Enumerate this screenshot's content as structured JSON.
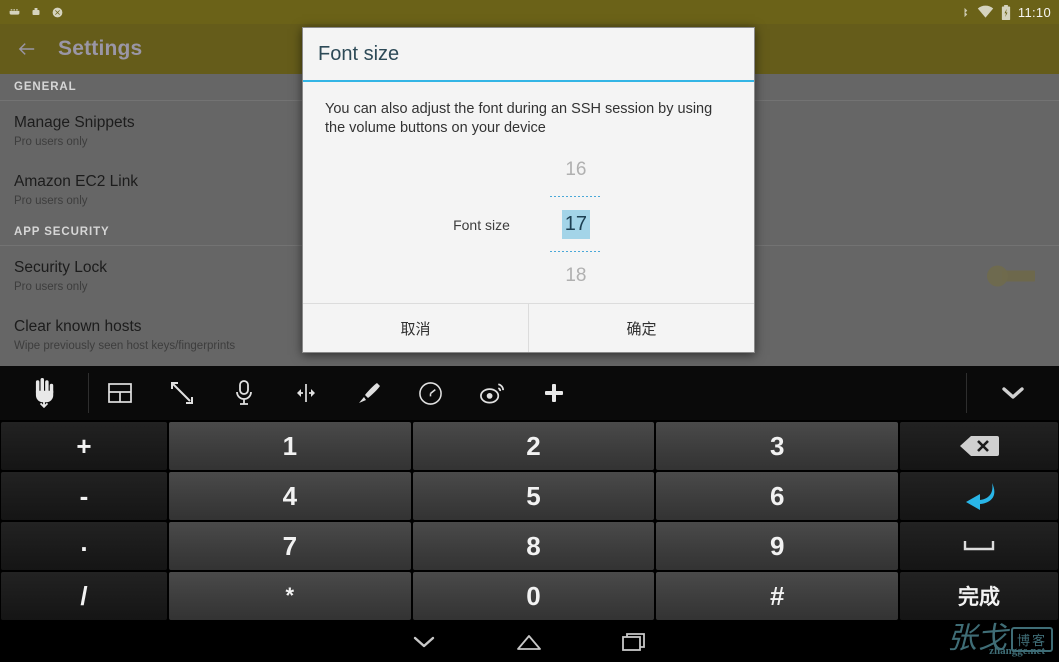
{
  "status_bar": {
    "time": "11:10",
    "left_icons": [
      "usb-icon",
      "alarm-icon",
      "app-notification-icon"
    ],
    "right_icons": [
      "bluetooth-icon",
      "wifi-icon",
      "battery-charging-icon"
    ]
  },
  "app_bar": {
    "back_icon": "back-arrow-icon",
    "title": "Settings",
    "bg_color": "#655C1A",
    "title_color": "#9a96a6"
  },
  "settings": {
    "sections": [
      {
        "header": "GENERAL",
        "rows": [
          {
            "title": "Manage Snippets",
            "subtitle": "Pro users only",
            "has_switch": false
          },
          {
            "title": "Amazon EC2 Link",
            "subtitle": "Pro users only",
            "has_switch": false
          }
        ]
      },
      {
        "header": "APP SECURITY",
        "rows": [
          {
            "title": "Security Lock",
            "subtitle": "Pro users only",
            "has_switch": true
          },
          {
            "title": "Clear known hosts",
            "subtitle": "Wipe previously seen host keys/fingerprints",
            "has_switch": false
          }
        ]
      }
    ]
  },
  "dialog": {
    "title": "Font size",
    "accent_color": "#33b5e5",
    "message": "You can also adjust the font during an SSH session by using the volume buttons on your device",
    "picker": {
      "label": "Font size",
      "previous_value": "16",
      "current_value": "17",
      "next_value": "18",
      "selection_color": "#a3d4e8"
    },
    "buttons": {
      "cancel": "取消",
      "ok": "确定"
    }
  },
  "ime_toolbar": {
    "first_icon": "hand-pointer-icon",
    "icons": [
      "layout-grid-icon",
      "expand-arrows-icon",
      "microphone-icon",
      "cursor-move-icon",
      "handwriting-pen-icon",
      "clock-icon",
      "weibo-icon",
      "plus-icon"
    ],
    "collapse_icon": "chevron-down-icon"
  },
  "keyboard": {
    "rows": [
      [
        {
          "label": "+",
          "type": "side",
          "name": "key-plus"
        },
        {
          "label": "1",
          "type": "num",
          "name": "key-1"
        },
        {
          "label": "2",
          "type": "num",
          "name": "key-2"
        },
        {
          "label": "3",
          "type": "num",
          "name": "key-3"
        },
        {
          "label": "",
          "type": "right",
          "name": "key-backspace",
          "icon": "backspace-icon"
        }
      ],
      [
        {
          "label": "-",
          "type": "side",
          "name": "key-minus"
        },
        {
          "label": "4",
          "type": "num",
          "name": "key-4"
        },
        {
          "label": "5",
          "type": "num",
          "name": "key-5"
        },
        {
          "label": "6",
          "type": "num",
          "name": "key-6"
        },
        {
          "label": "",
          "type": "right",
          "name": "key-enter",
          "icon": "enter-return-icon"
        }
      ],
      [
        {
          "label": ".",
          "type": "side",
          "name": "key-period"
        },
        {
          "label": "7",
          "type": "num",
          "name": "key-7"
        },
        {
          "label": "8",
          "type": "num",
          "name": "key-8"
        },
        {
          "label": "9",
          "type": "num",
          "name": "key-9"
        },
        {
          "label": "",
          "type": "right",
          "name": "key-space",
          "icon": "space-bar-icon"
        }
      ],
      [
        {
          "label": "/",
          "type": "side",
          "name": "key-slash"
        },
        {
          "label": "*",
          "type": "num",
          "name": "key-asterisk"
        },
        {
          "label": "0",
          "type": "num",
          "name": "key-0"
        },
        {
          "label": "#",
          "type": "num",
          "name": "key-hash"
        },
        {
          "label": "完成",
          "type": "right",
          "name": "key-done"
        }
      ]
    ]
  },
  "nav_bar": {
    "back_icon": "chevron-down-back-icon",
    "home_icon": "home-icon",
    "recents_icon": "recents-icon"
  },
  "watermark": {
    "signature": "张戈",
    "badge": "博客",
    "url": "zhangge.net",
    "color": "#3f6d76"
  }
}
